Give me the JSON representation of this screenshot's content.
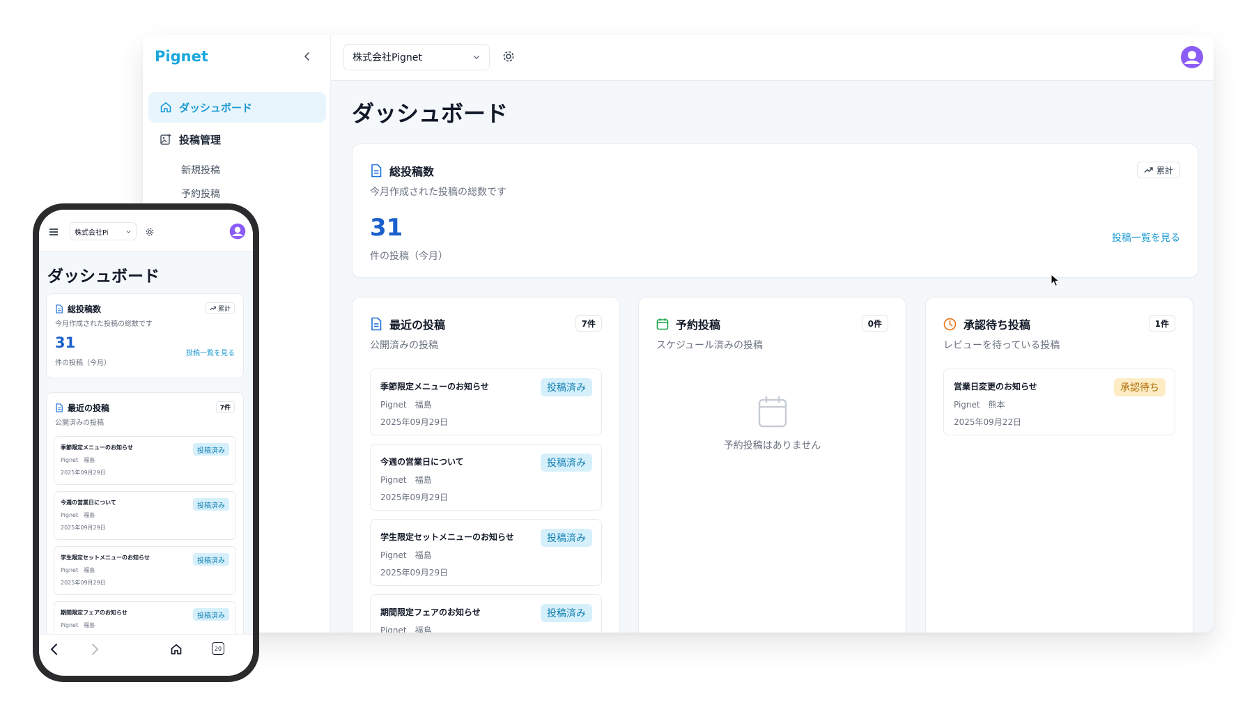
{
  "app": {
    "name": "Pignet"
  },
  "colors": {
    "accent": "#1aa7dc",
    "number": "#1a5fcb",
    "posted_bg": "#d6f0fb",
    "pending_bg": "#fdecc4"
  },
  "sidebar": {
    "items": [
      {
        "label": "ダッシュボード",
        "icon": "home-icon",
        "active": true
      },
      {
        "label": "投稿管理",
        "icon": "image-edit-icon"
      }
    ],
    "sub_items": [
      "新規投稿",
      "予約投稿"
    ]
  },
  "header": {
    "company": "株式会社Pignet"
  },
  "page": {
    "title": "ダッシュボード"
  },
  "total_card": {
    "title": "総投稿数",
    "subtitle": "今月作成された投稿の総数です",
    "badge": "累計",
    "value": "31",
    "unit": "件の投稿（今月）",
    "link": "投稿一覧を見る"
  },
  "recent": {
    "title": "最近の投稿",
    "subtitle": "公開済みの投稿",
    "count": "7件",
    "items": [
      {
        "title": "季節限定メニューのお知らせ",
        "author": "Pignet　福島",
        "date": "2025年09月29日",
        "status": "投稿済み"
      },
      {
        "title": "今週の営業日について",
        "author": "Pignet　福島",
        "date": "2025年09月29日",
        "status": "投稿済み"
      },
      {
        "title": "学生限定セットメニューのお知らせ",
        "author": "Pignet　福島",
        "date": "2025年09月29日",
        "status": "投稿済み"
      },
      {
        "title": "期間限定フェアのお知らせ",
        "author": "Pignet　福島",
        "date": "",
        "status": "投稿済み"
      }
    ]
  },
  "scheduled": {
    "title": "予約投稿",
    "subtitle": "スケジュール済みの投稿",
    "count": "0件",
    "empty": "予約投稿はありません"
  },
  "pending": {
    "title": "承認待ち投稿",
    "subtitle": "レビューを待っている投稿",
    "count": "1件",
    "items": [
      {
        "title": "営業日変更のお知らせ",
        "author": "Pignet　熊本",
        "date": "2025年09月22日",
        "status": "承認待ち"
      }
    ]
  },
  "mobile": {
    "company": "株式会社Pi",
    "title": "ダッシュボード",
    "total": {
      "title": "総投稿数",
      "subtitle": "今月作成された投稿の総数です",
      "badge": "累計",
      "value": "31",
      "unit": "件の投稿（今月）",
      "link": "投稿一覧を見る"
    },
    "recent": {
      "title": "最近の投稿",
      "subtitle": "公開済みの投稿",
      "count": "7件",
      "items": [
        {
          "title": "季節限定メニューのお知らせ",
          "author": "Pignet　福島",
          "date": "2025年09月29日",
          "status": "投稿済み"
        },
        {
          "title": "今週の営業日について",
          "author": "Pignet　福島",
          "date": "2025年09月29日",
          "status": "投稿済み"
        },
        {
          "title": "学生限定セットメニューのお知らせ",
          "author": "Pignet　福島",
          "date": "2025年09月29日",
          "status": "投稿済み"
        },
        {
          "title": "期間限定フェアのお知らせ",
          "author": "Pignet　福島",
          "date": "",
          "status": "投稿済み"
        }
      ]
    },
    "tab_count": "20"
  }
}
